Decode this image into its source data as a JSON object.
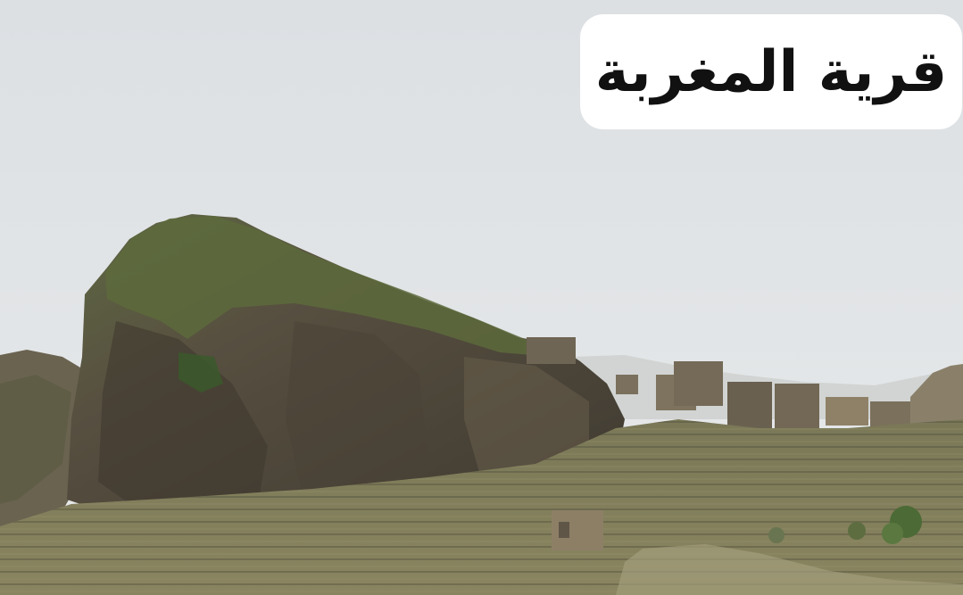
{
  "caption": {
    "text": "قرية المغربة"
  },
  "colors": {
    "sky_top": "#dde1e4",
    "sky_bottom": "#e6e9ea",
    "rock_dark": "#4d473c",
    "rock_mid": "#6b6250",
    "vegetation": "#5c6b3f",
    "terrace": "#7d7b5c",
    "building": "#8a7e68",
    "caption_bg": "#ffffff",
    "caption_text": "#111111"
  }
}
